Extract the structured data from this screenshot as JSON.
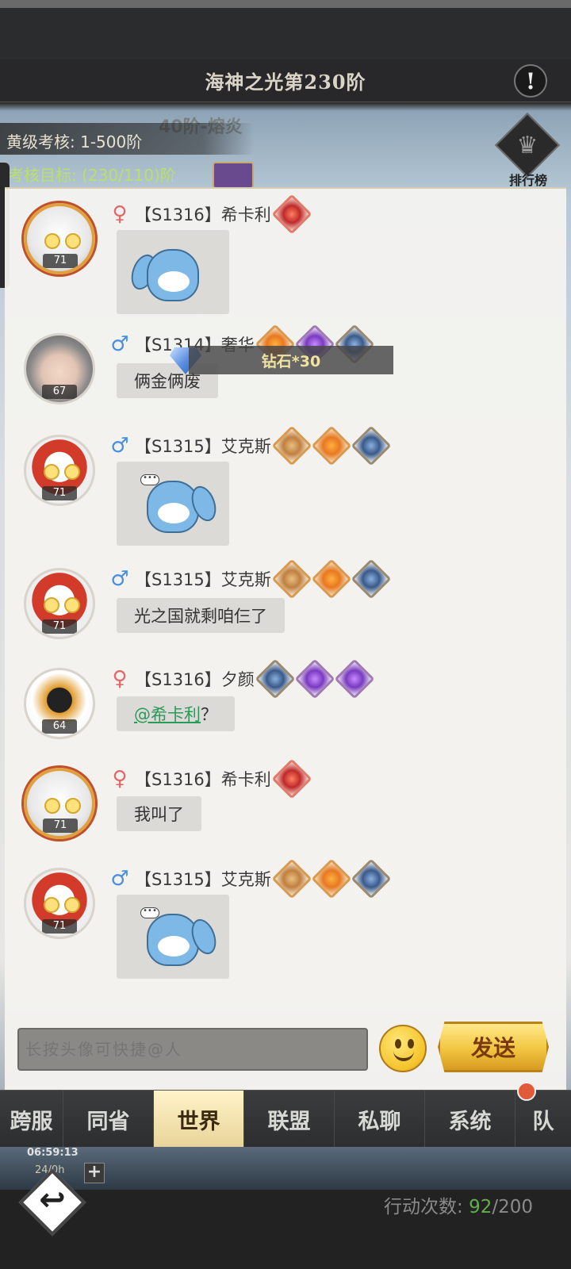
{
  "header": {
    "title": "海神之光第230阶",
    "info_icon": "exclamation-icon",
    "background_floor_text": "40阶-熔炎"
  },
  "exam": {
    "level_label": "黄级考核: 1-500阶",
    "goal_label": "考核目标: (230/110)阶"
  },
  "ranking": {
    "label": "排行榜",
    "icon": "trophy-icon"
  },
  "messages": [
    {
      "gender": "♀",
      "server": "【S1316】",
      "name": "希卡利",
      "level": "71",
      "type": "sticker"
    },
    {
      "gender": "♂",
      "server": "【S1314】",
      "name": "奢华",
      "level": "67",
      "type": "text",
      "text": "俩金俩废"
    },
    {
      "gender": "♂",
      "server": "【S1315】",
      "name": "艾克斯",
      "level": "71",
      "type": "sticker"
    },
    {
      "gender": "♂",
      "server": "【S1315】",
      "name": "艾克斯",
      "level": "71",
      "type": "text",
      "text": "光之国就剩咱仨了"
    },
    {
      "gender": "♀",
      "server": "【S1316】",
      "name": "夕颜",
      "level": "64",
      "type": "mention",
      "mention": "@希卡利",
      "text": "？"
    },
    {
      "gender": "♀",
      "server": "【S1316】",
      "name": "希卡利",
      "level": "71",
      "type": "text",
      "text": "我叫了"
    },
    {
      "gender": "♂",
      "server": "【S1315】",
      "name": "艾克斯",
      "level": "71",
      "type": "sticker"
    }
  ],
  "toast": {
    "text": "钻石*30",
    "icon": "diamond-icon"
  },
  "input": {
    "placeholder": "长按头像可快捷@人",
    "value": ""
  },
  "emoji_icon": "smiley-icon",
  "send_label": "发送",
  "tabs": [
    "跨服",
    "同省",
    "世界",
    "联盟",
    "私聊",
    "系统",
    "队"
  ],
  "active_tab": "世界",
  "footer": {
    "timer": "06:59:13",
    "energy": "24/0h",
    "action_label": "行动次数: ",
    "action_current": "92",
    "action_max": "/200"
  },
  "colors": {
    "mention": "#2a9a5a",
    "female": "#e06a6a",
    "male": "#4a8ee0",
    "send_button": "#f2c640",
    "action_current": "#5fb04a"
  }
}
